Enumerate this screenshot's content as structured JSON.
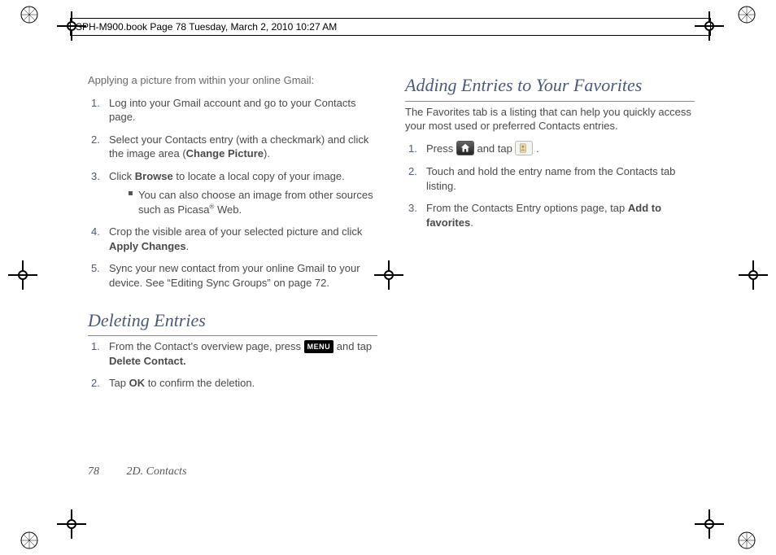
{
  "crop_label": "SPH-M900.book  Page 78  Tuesday, March 2, 2010  10:27 AM",
  "left": {
    "lead": "Applying a picture from within your online Gmail:",
    "steps": [
      {
        "n": "1.",
        "body": "Log into your Gmail account and go to your Contacts page."
      },
      {
        "n": "2.",
        "body_pre": "Select your Contacts entry (with a checkmark) and click the image area (",
        "bold": "Change Picture",
        "body_post": ")."
      },
      {
        "n": "3.",
        "body_pre": "Click ",
        "bold": "Browse",
        "body_post": " to locate a local copy of your image.",
        "sub": {
          "pre": "You can also choose an image from other sources such as Picasa",
          "sup": "®",
          "post": " Web."
        }
      },
      {
        "n": "4.",
        "body_pre": "Crop the visible area of your selected picture and click ",
        "bold": "Apply Changes",
        "body_post": "."
      },
      {
        "n": "5.",
        "body": "Sync your new contact from your online Gmail to your device. See “Editing Sync Groups” on page 72."
      }
    ],
    "heading": "Deleting Entries",
    "del_steps": [
      {
        "n": "1.",
        "pre": "From the Contact’s overview page, press ",
        "chip": "MENU",
        "mid": " and tap ",
        "bold": "Delete Contact."
      },
      {
        "n": "2.",
        "pre": "Tap ",
        "bold": "OK",
        "post": " to confirm the deletion."
      }
    ]
  },
  "right": {
    "heading": "Adding Entries to Your Favorites",
    "intro": "The Favorites tab is a listing that can help you quickly access your most used or preferred Contacts entries.",
    "steps": [
      {
        "n": "1.",
        "pre": "Press ",
        "chip1": "home",
        "mid": " and tap ",
        "chip2": "contacts",
        "post": " ."
      },
      {
        "n": "2.",
        "body": "Touch and hold the entry name from the Contacts tab listing."
      },
      {
        "n": "3.",
        "pre": "From the Contacts Entry options page, tap ",
        "bold": "Add to favorites",
        "post": "."
      }
    ]
  },
  "footer": {
    "page": "78",
    "section": "2D. Contacts"
  }
}
